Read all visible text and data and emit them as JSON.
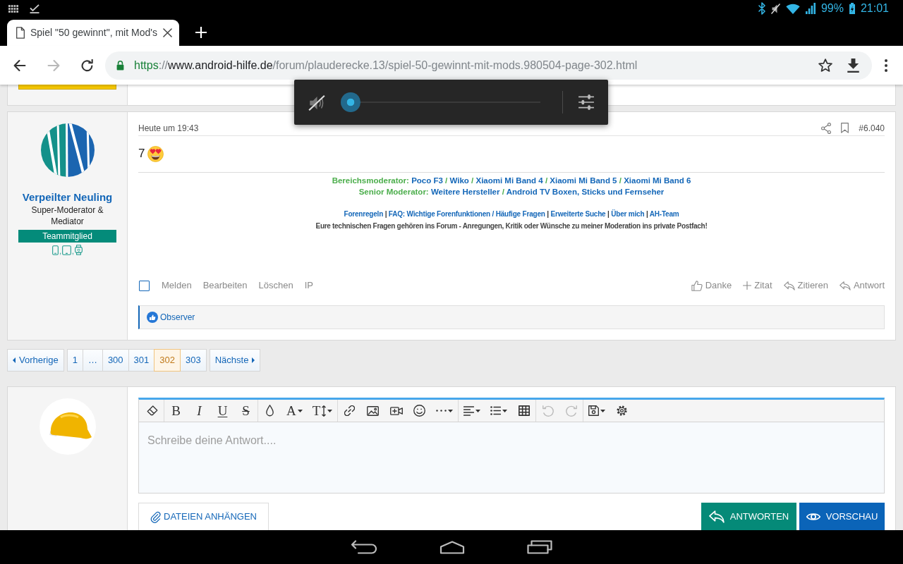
{
  "status_bar": {
    "battery": "99%",
    "time": "21:01"
  },
  "browser": {
    "tabs": [
      {
        "title": "Spiel \"50 gewinnt\", mit Mod's",
        "selected": true
      }
    ],
    "nav_buttons": [
      {
        "kind": "back",
        "disabled": false
      },
      {
        "kind": "forward",
        "disabled": true
      },
      {
        "kind": "reload",
        "disabled": false
      }
    ],
    "url": {
      "scheme": "https",
      "separator": "://",
      "host": "www.android-hilfe.de",
      "path": "/forum/plauderecke.13/spiel-50-gewinnt-mit-mods.980504-page-302.html"
    }
  },
  "volume_panel": {
    "muted": true,
    "level": 0
  },
  "post": {
    "author": {
      "name": "Verpeilter Neuling",
      "title": "Super-Moderator & Mediator",
      "badge": "Teammitglied",
      "devices": [
        {
          "kind": "phone",
          "separator": ","
        },
        {
          "kind": "tablet",
          "separator": ","
        },
        {
          "kind": "watch"
        }
      ]
    },
    "time": "Heute um 19:43",
    "number": "#6.040",
    "body": "7",
    "signature": [
      {
        "kind": "role",
        "segments": [
          {
            "kind": "label",
            "text": "Bereichsmoderator:"
          },
          {
            "kind": "link",
            "text": "Poco F3"
          },
          {
            "kind": "separator",
            "text": "/"
          },
          {
            "kind": "link",
            "text": "Wiko"
          },
          {
            "kind": "separator",
            "text": "/"
          },
          {
            "kind": "link",
            "text": "Xiaomi Mi Band 4"
          },
          {
            "kind": "separator",
            "text": "/"
          },
          {
            "kind": "link",
            "text": "Xiaomi Mi Band 5"
          },
          {
            "kind": "separator",
            "text": "/"
          },
          {
            "kind": "link",
            "text": "Xiaomi Mi Band 6"
          }
        ]
      },
      {
        "kind": "role",
        "segments": [
          {
            "kind": "label",
            "text": "Senior Moderator:"
          },
          {
            "kind": "link",
            "text": "Weitere Hersteller"
          },
          {
            "kind": "separator",
            "text": "/"
          },
          {
            "kind": "link",
            "text": "Android TV Boxen, Sticks und Fernseher"
          }
        ]
      },
      {
        "kind": "links",
        "segments": [
          {
            "kind": "link",
            "text": "Forenregeln"
          },
          {
            "kind": "separator",
            "text": "|"
          },
          {
            "kind": "link",
            "text": "FAQ: Wichtige Forenfunktionen / Häufige Fragen"
          },
          {
            "kind": "separator",
            "text": "|"
          },
          {
            "kind": "link",
            "text": "Erweiterte Suche"
          },
          {
            "kind": "separator",
            "text": "|"
          },
          {
            "kind": "link",
            "text": "Über mich"
          },
          {
            "kind": "separator",
            "text": "|"
          },
          {
            "kind": "link",
            "text": "AH-Team"
          }
        ]
      },
      {
        "kind": "note",
        "segments": [
          {
            "kind": "text",
            "text": "Eure technischen Fragen gehören ins Forum - Anregungen, Kritik oder Wünsche zu meiner Moderation ins private Postfach!"
          }
        ]
      }
    ],
    "selected": false,
    "actions_left": [
      "Melden",
      "Bearbeiten",
      "Löschen",
      "IP"
    ],
    "actions_right": [
      {
        "kind": "like",
        "label": "Danke"
      },
      {
        "kind": "add",
        "label": "Zitat"
      },
      {
        "kind": "quote",
        "label": "Zitieren"
      },
      {
        "kind": "reply",
        "label": "Antwort"
      }
    ],
    "reactions": [
      "Observer"
    ]
  },
  "pagination": {
    "previous": "Vorherige",
    "pages": [
      {
        "label": "1",
        "selected": false
      },
      {
        "label": "…",
        "selected": false
      },
      {
        "label": "300",
        "selected": false
      },
      {
        "label": "301",
        "selected": false
      },
      {
        "label": "302",
        "selected": true
      },
      {
        "label": "303",
        "selected": false
      }
    ],
    "next": "Nächste"
  },
  "reply_editor": {
    "toolbar": [
      {
        "items": [
          {
            "kind": "clear",
            "disabled": false
          }
        ]
      },
      {
        "items": [
          {
            "kind": "bold",
            "text": "B",
            "disabled": false
          },
          {
            "kind": "italic",
            "text": "I",
            "disabled": false
          },
          {
            "kind": "underline",
            "text": "U",
            "disabled": false
          },
          {
            "kind": "strike",
            "text": "S",
            "disabled": false
          }
        ]
      },
      {
        "items": [
          {
            "kind": "color",
            "disabled": false
          },
          {
            "kind": "font",
            "text": "A",
            "disabled": false
          },
          {
            "kind": "size",
            "text": "T",
            "disabled": false
          }
        ]
      },
      {
        "items": [
          {
            "kind": "link",
            "disabled": false
          },
          {
            "kind": "image",
            "disabled": false
          },
          {
            "kind": "media",
            "disabled": false
          },
          {
            "kind": "smilie",
            "disabled": false
          },
          {
            "kind": "more",
            "disabled": false
          }
        ]
      },
      {
        "items": [
          {
            "kind": "align",
            "disabled": false
          },
          {
            "kind": "list",
            "disabled": false
          },
          {
            "kind": "table",
            "disabled": false
          }
        ]
      },
      {
        "items": [
          {
            "kind": "undo",
            "disabled": true
          },
          {
            "kind": "redo",
            "disabled": true
          }
        ]
      },
      {
        "items": [
          {
            "kind": "drafts",
            "disabled": false
          },
          {
            "kind": "settings",
            "disabled": false
          }
        ]
      }
    ],
    "placeholder": "Schreibe deine Antwort....",
    "attach": "DATEIEN ANHÄNGEN",
    "buttons": [
      {
        "kind": "reply",
        "label": "ANTWORTEN"
      },
      {
        "kind": "preview",
        "label": "VORSCHAU"
      }
    ]
  }
}
